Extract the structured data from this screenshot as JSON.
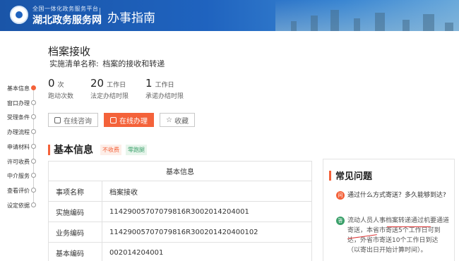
{
  "header": {
    "brand_small": "全国一体化政务服务平台",
    "brand_big": "湖北政务服务网",
    "page_title": "办事指南"
  },
  "service": {
    "title": "档案接收",
    "impl_name_label": "实施清单名称:",
    "impl_name_value": "档案的接收和转递"
  },
  "stats": [
    {
      "num": "0",
      "unit": "次",
      "label": "跑动次数"
    },
    {
      "num": "20",
      "unit": "工作日",
      "label": "法定办结时限"
    },
    {
      "num": "1",
      "unit": "工作日",
      "label": "承诺办结时限"
    }
  ],
  "actions": {
    "consult": "在线咨询",
    "apply": "在线办理",
    "favorite": "收藏"
  },
  "nav": [
    {
      "label": "基本信息",
      "active": true
    },
    {
      "label": "窗口办理",
      "active": false
    },
    {
      "label": "受理条件",
      "active": false
    },
    {
      "label": "办理流程",
      "active": false
    },
    {
      "label": "申请材料",
      "active": false
    },
    {
      "label": "许可收费",
      "active": false
    },
    {
      "label": "中介服务",
      "active": false
    },
    {
      "label": "查看评价",
      "active": false
    },
    {
      "label": "设定依据",
      "active": false
    }
  ],
  "section": {
    "title": "基本信息",
    "tag_fee": "不收费",
    "tag_zero": "零跑腿"
  },
  "table": {
    "caption": "基本信息",
    "rows": [
      {
        "key": "事项名称",
        "value": "档案接收"
      },
      {
        "key": "实施编码",
        "value": "11429005707079816R3002014204001"
      },
      {
        "key": "业务编码",
        "value": "11429005707079816R300201420400102"
      },
      {
        "key": "基本编码",
        "value": "002014204001"
      }
    ]
  },
  "faq": {
    "title": "常见问题",
    "badge_q": "问",
    "badge_a": "答",
    "question": "通过什么方式寄送？多久能够到达?",
    "answer": "流动人员人事档案转递通过机要通道寄送，本省市寄送5个工作日可到达，外省市寄送10个工作日到达（以寄出日开始计算时间）。"
  },
  "colors": {
    "accent": "#f4623a",
    "header_blue": "#1f63bf",
    "green": "#3aa06a"
  }
}
